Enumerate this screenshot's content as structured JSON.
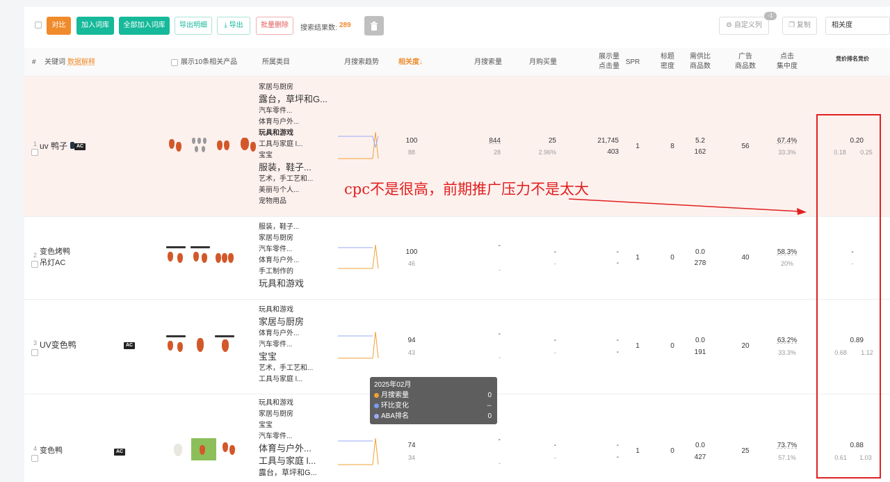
{
  "toolbar": {
    "compare": "对比",
    "add_to_library": "加入词库",
    "add_all_to_library": "全部加入词库",
    "export_detail": "导出明细",
    "export": "导出",
    "batch_delete": "批量删除",
    "result_label": "搜索结果数:",
    "result_count": "289",
    "custom_columns": "自定义列",
    "custom_columns_badge": "-1",
    "copy": "复制",
    "sort_value": "相关度"
  },
  "headers": {
    "index": "#",
    "keyword": "关键词",
    "data_explain": "数据解释",
    "show_products": "展示10条相关产品",
    "category": "所属类目",
    "monthly_trend": "月搜索趋势",
    "relevance": "相关度↓",
    "monthly_search": "月搜索量",
    "monthly_purchase": "月购买量",
    "impressions_1": "展示量",
    "impressions_2": "点击量",
    "spr": "SPR",
    "title_density_1": "标题",
    "title_density_2": "密度",
    "supply_ratio_1": "需供比",
    "supply_ratio_2": "商品数",
    "ad_products_1": "广告",
    "ad_products_2": "商品数",
    "click_conc_1": "点击",
    "click_conc_2": "集中度",
    "bid_rank": "竞价排名竞价"
  },
  "rows": [
    {
      "index": "1",
      "keyword": "uv 鸭子",
      "ac": "AC",
      "categories": [
        "家居与厨房",
        "露台，草坪和G...",
        "汽车零件...",
        "体育与户外...",
        "玩具和游戏",
        "工具与家庭 l...",
        "宝宝",
        "服装，鞋子...",
        "艺术，手工艺和...",
        "美丽与个人...",
        "宠物用品"
      ],
      "relevance": "100",
      "relevance_sub": "88",
      "monthly_search": "844",
      "monthly_search_sub": "28",
      "monthly_purchase": "25",
      "monthly_purchase_sub": "2.96%",
      "impressions": "21,745",
      "clicks": "403",
      "spr": "1",
      "title_density": "8",
      "supply_ratio": "5.2",
      "product_count": "162",
      "ad_products": "56",
      "click_conc": "67.4%",
      "click_conc_sub": "33.3%",
      "bid_main": "0.20",
      "bid_low": "0.18",
      "bid_high": "0.25"
    },
    {
      "index": "2",
      "keyword_line1": "变色烤鸭",
      "keyword_line2": "吊灯AC",
      "categories": [
        "服装，鞋子...",
        "家居与厨房",
        "汽车零件...",
        "体育与户外...",
        "手工制作的",
        "玩具和游戏"
      ],
      "relevance": "100",
      "relevance_sub": "46",
      "monthly_search": "-",
      "monthly_search_sub": "-",
      "monthly_purchase": "-",
      "monthly_purchase_sub": "-",
      "impressions": "-",
      "clicks": "-",
      "spr": "1",
      "title_density": "0",
      "supply_ratio": "0.0",
      "product_count": "278",
      "ad_products": "40",
      "click_conc": "58.3%",
      "click_conc_sub": "20%",
      "bid_main": "-",
      "bid_sub": "-"
    },
    {
      "index": "3",
      "keyword": "UV变色鸭",
      "ac": "AC",
      "categories": [
        "玩具和游戏",
        "家居与厨房",
        "体育与户外...",
        "汽车零件...",
        "宝宝",
        "艺术，手工艺和...",
        "工具与家庭 l..."
      ],
      "relevance": "94",
      "relevance_sub": "43",
      "monthly_search": "-",
      "monthly_search_sub": "-",
      "monthly_purchase": "-",
      "monthly_purchase_sub": "-",
      "impressions": "-",
      "clicks": "-",
      "spr": "1",
      "title_density": "0",
      "supply_ratio": "0.0",
      "product_count": "191",
      "ad_products": "20",
      "click_conc": "63.2%",
      "click_conc_sub": "33.3%",
      "bid_main": "0.89",
      "bid_low": "0.68",
      "bid_high": "1.12"
    },
    {
      "index": "4",
      "keyword": "变色鸭",
      "ac": "AC",
      "categories": [
        "玩具和游戏",
        "家居与厨房",
        "宝宝",
        "汽车零件...",
        "体育与户外...",
        "工具与家庭 l...",
        "露台，草坪和G..."
      ],
      "relevance": "74",
      "relevance_sub": "34",
      "monthly_search": "-",
      "monthly_search_sub": "-",
      "monthly_purchase": "-",
      "monthly_purchase_sub": "-",
      "impressions": "-",
      "clicks": "-",
      "spr": "1",
      "title_density": "0",
      "supply_ratio": "0.0",
      "product_count": "427",
      "ad_products": "25",
      "click_conc": "73.7%",
      "click_conc_sub": "57.1%",
      "bid_main": "0.88",
      "bid_low": "0.61",
      "bid_high": "1.03"
    }
  ],
  "tooltip": {
    "title": "2025年02月",
    "items": [
      {
        "label": "月搜索量",
        "value": "0",
        "color": "#f0a030"
      },
      {
        "label": "环比变化",
        "value": "--",
        "color": "#7a9cf0"
      },
      {
        "label": "ABA排名",
        "value": "0",
        "color": "#9aaaf5"
      }
    ]
  },
  "annotation": {
    "text": "cpc不是很高，前期推广压力不是太大",
    "color": "#e02020"
  }
}
